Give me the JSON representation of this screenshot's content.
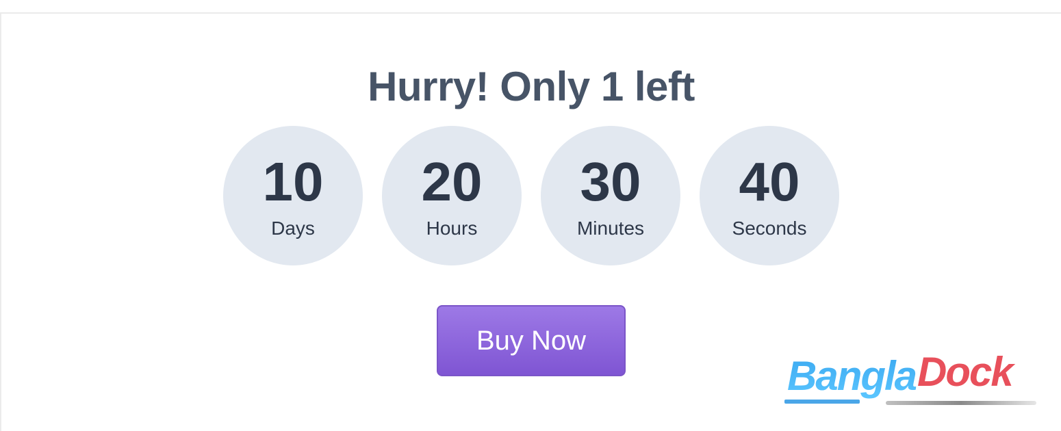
{
  "headline": "Hurry! Only 1 left",
  "countdown": [
    {
      "value": "10",
      "unit": "Days"
    },
    {
      "value": "20",
      "unit": "Hours"
    },
    {
      "value": "30",
      "unit": "Minutes"
    },
    {
      "value": "40",
      "unit": "Seconds"
    }
  ],
  "button": {
    "label": "Buy Now"
  },
  "watermark": {
    "part1": "Bangla",
    "part2": "Dock"
  },
  "colors": {
    "headline": "#475467",
    "circle_bg": "#e2e8f0",
    "number": "#2d3748",
    "button_top": "#9d79e6",
    "button_bottom": "#7f55d3",
    "logo_blue": "#3aa8f0",
    "logo_red": "#e8505b"
  }
}
